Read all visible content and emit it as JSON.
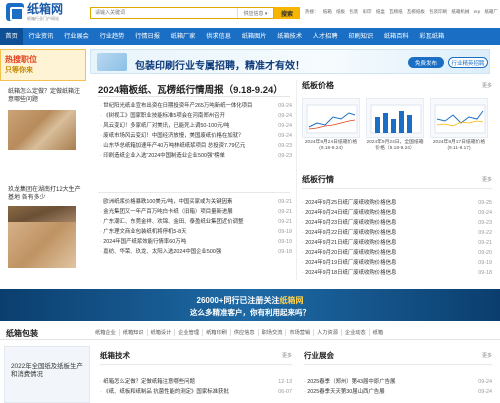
{
  "header": {
    "logo_name": "纸箱网",
    "logo_sub": "纸箱行业门户网站",
    "search_placeholder": "请输入关键词",
    "search_scope": "供应信息 ▾",
    "search_button": "搜索",
    "hot_words": [
      "热搜：",
      "纸箱",
      "纸板",
      "包装",
      "彩印",
      "纸盒",
      "瓦楞纸",
      "瓦楞纸板",
      "包装印刷",
      "纸箱机械",
      "erp",
      "纸箱厂"
    ]
  },
  "nav": {
    "items": [
      "首页",
      "行业资讯",
      "行业展会",
      "行业趋势",
      "行情日报",
      "纸箱厂家",
      "供求信息",
      "纸箱图片",
      "纸箱技术",
      "人才招聘",
      "印刷知识",
      "纸箱百科",
      "彩瓦纸箱"
    ]
  },
  "left": {
    "ad_line1": "热搜职位",
    "ad_line2": "只等你来",
    "articles": [
      {
        "title": "纸箱怎么定做？定做纸箱注意哪些问题"
      },
      {
        "title": "玖龙集团在湖南打12大生产基地 各有多少"
      },
      {
        "title": ""
      }
    ]
  },
  "banner": {
    "title": "包装印刷行业专属招聘，精准才有效！",
    "button_primary": "免费发布",
    "button_secondary": "行业精英招聘"
  },
  "headline": "2024箱板纸、瓦楞纸行情周报（9.18-9.24）",
  "news_group1": [
    {
      "title": "世纪阳光纸业宣布出资在日期投资年产265万吨新纸一体化项目",
      "date": "09-24"
    },
    {
      "title": "《树视工》国家职业技能标准5项会在河南郑州召开",
      "date": "09-24"
    },
    {
      "title": "风云变幻！多家纸厂对美讯，已能死上调50-100元/吨",
      "date": "09-24"
    },
    {
      "title": "废纸市场风云变幻！中国经济放慢，美国废纸价格在加就？",
      "date": "09-24"
    },
    {
      "title": "山东华总纸箱加速年产40万吨林纸纸浆项目 总投资7.79亿元",
      "date": "09-23"
    },
    {
      "title": "印刷造纸企业入选“2024中国制造业企业500强”榜单",
      "date": "09-23"
    }
  ],
  "news_group2": [
    {
      "title": "欧洲纸浆价格暴跌100美元/吨，中国买家或为关键因素",
      "date": "09-21"
    },
    {
      "title": "金光集团又一年产百万吨白卡纸（旧箱）项目量新进展",
      "date": "09-21"
    },
    {
      "title": "广东潮汇、东莞金祥、欢锦、金田、泰盈纸业集团近价调整",
      "date": "09-21"
    },
    {
      "title": "广东理文商业包装纸机将停机5-8天",
      "date": "09-19"
    },
    {
      "title": "2024年国产纸浆效能行情率60万吨",
      "date": "09-19"
    },
    {
      "title": "嘉纺、华荣、玖龙、太阳入选2024中国企业500强",
      "date": "09-18"
    }
  ],
  "right": {
    "price_title": "纸板价格",
    "price_more": "更多",
    "price_cards": [
      {
        "caption": "2024年9月24日纸箱价格 (9.18-9.24)"
      },
      {
        "caption": "2024年9月24日，全国纸箱价格（9.18-9.24）"
      },
      {
        "caption": "2024年9月17日纸箱价格 (9.11-9.17)"
      }
    ],
    "trend_title": "纸板行情",
    "trend_more": "更多",
    "trends": [
      {
        "title": "2024年9月25日纸厂废纸收购价格信息",
        "date": "09-25"
      },
      {
        "title": "2024年9月24日纸厂废纸收购价格信息",
        "date": "09-24"
      },
      {
        "title": "2024年9月23日纸厂废纸收购价格信息",
        "date": "09-23"
      },
      {
        "title": "2024年9月22日纸厂废纸收购价格信息",
        "date": "09-22"
      },
      {
        "title": "2024年9月21日纸厂废纸收购价格信息",
        "date": "09-21"
      },
      {
        "title": "2024年9月20日纸厂废纸收购价格信息",
        "date": "09-20"
      },
      {
        "title": "2024年9月19日纸厂废纸收购价格信息",
        "date": "09-19"
      },
      {
        "title": "2024年9月18日纸厂废纸收购价格信息",
        "date": "09-18"
      }
    ]
  },
  "bigad": {
    "line1_prefix": "26000+同行已注册关注",
    "line1_brand": "纸箱网",
    "line2": "这么多精准客户，你有利用起来吗？"
  },
  "bottom": {
    "section_title": "纸箱包装",
    "subnav": [
      "纸箱企业",
      "纸箱知识",
      "纸箱设计",
      "企业管理",
      "纸箱印刷",
      "供应信息",
      "职场交流",
      "市场营销",
      "人力资源",
      "企业动态",
      "纸箱"
    ],
    "left_box_text": "2022年全国纸及纸板生产和消费情况",
    "tech_title": "纸箱技术",
    "tech_more": "更多",
    "tech_list": [
      {
        "title": "纸箱怎么定做？定做纸箱注意哪些问题",
        "date": "12-13"
      },
      {
        "title": "《纸、纸板和纸制品 抗菌性能的测定》国家标准获批",
        "date": "06-07"
      }
    ],
    "expo_title": "行业展会",
    "expo_more": "更多",
    "expo_list": [
      {
        "title": "2025春季（郑州）第43届中原广告展",
        "date": "09-24"
      },
      {
        "title": "2025春季天天第30届山西广告展",
        "date": "09-24"
      }
    ]
  },
  "colors": {
    "brand_blue": "#1a6fc4",
    "search_accent": "#f7b500"
  }
}
